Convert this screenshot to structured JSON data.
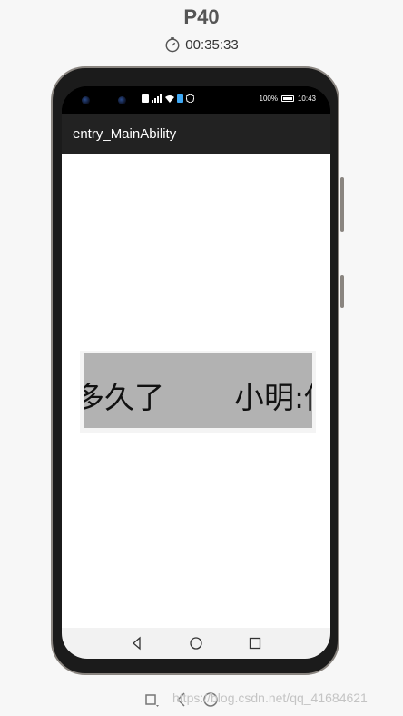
{
  "device": {
    "name": "P40",
    "timer": "00:35:33"
  },
  "status_bar": {
    "battery": "100%",
    "time": "10:43"
  },
  "app": {
    "title": "entry_MainAbility",
    "marquee_visible_text_a": "多久了",
    "marquee_visible_text_b": "小明:你"
  },
  "watermark": "https://blog.csdn.net/qq_41684621",
  "colors": {
    "app_bar": "#222222",
    "marquee_bg": "#b2b2b2",
    "content_bg": "#ffffff",
    "page_bg": "#f7f7f7"
  }
}
